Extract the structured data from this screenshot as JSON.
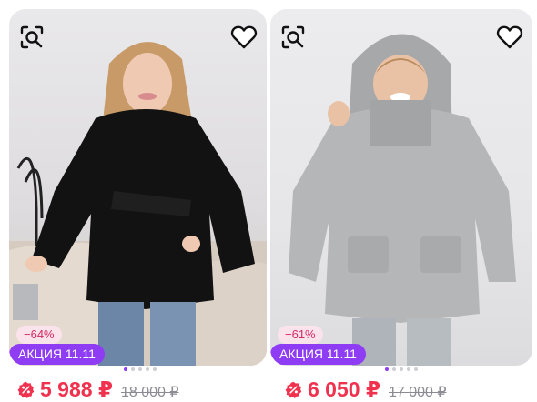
{
  "colors": {
    "accent": "#8e3df5",
    "price": "#f0324f",
    "discount_bg": "#fbe3ec",
    "discount_text": "#d42a64"
  },
  "products": [
    {
      "discount": "−64%",
      "promo": "АКЦИЯ 11.11",
      "price": "5 988 ₽",
      "old_price": "18 000 ₽",
      "image_alt": "black puffer jacket",
      "icons": [
        "image-search-icon",
        "heart-icon",
        "wallet-badge-icon"
      ]
    },
    {
      "discount": "−61%",
      "promo": "АКЦИЯ 11.11",
      "price": "6 050 ₽",
      "old_price": "17 000 ₽",
      "image_alt": "grey hooded puffer jacket",
      "icons": [
        "image-search-icon",
        "heart-icon",
        "wallet-badge-icon"
      ]
    }
  ],
  "carousel": {
    "slides": 5,
    "active": 1
  }
}
